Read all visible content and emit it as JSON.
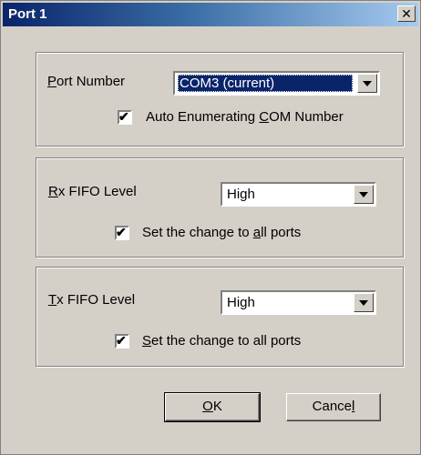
{
  "window": {
    "title": "Port 1",
    "close_glyph": "✕",
    "close_icon": "close-icon"
  },
  "port_group": {
    "port_number_label_mnemonic": "P",
    "port_number_label_rest": "ort Number",
    "port_number_value": "COM3 (current)",
    "auto_enum_checked": true,
    "auto_enum_label_pre": "Auto Enumerating ",
    "auto_enum_label_mnemonic": "C",
    "auto_enum_label_post": "OM Number"
  },
  "rx_group": {
    "label_mnemonic": "R",
    "label_rest": "x FIFO Level",
    "value": "High",
    "apply_all_checked": true,
    "apply_all_label_pre": "Set the change to ",
    "apply_all_label_mnemonic": "a",
    "apply_all_label_post": "ll ports"
  },
  "tx_group": {
    "label_mnemonic": "T",
    "label_rest": "x FIFO Level",
    "value": "High",
    "apply_all_checked": true,
    "apply_all_label_mnemonic": "S",
    "apply_all_label_post": "et the change to all ports"
  },
  "buttons": {
    "ok_mnemonic": "O",
    "ok_rest": "K",
    "cancel_pre": "Cance",
    "cancel_mnemonic": "l"
  },
  "check_glyph": "✔"
}
